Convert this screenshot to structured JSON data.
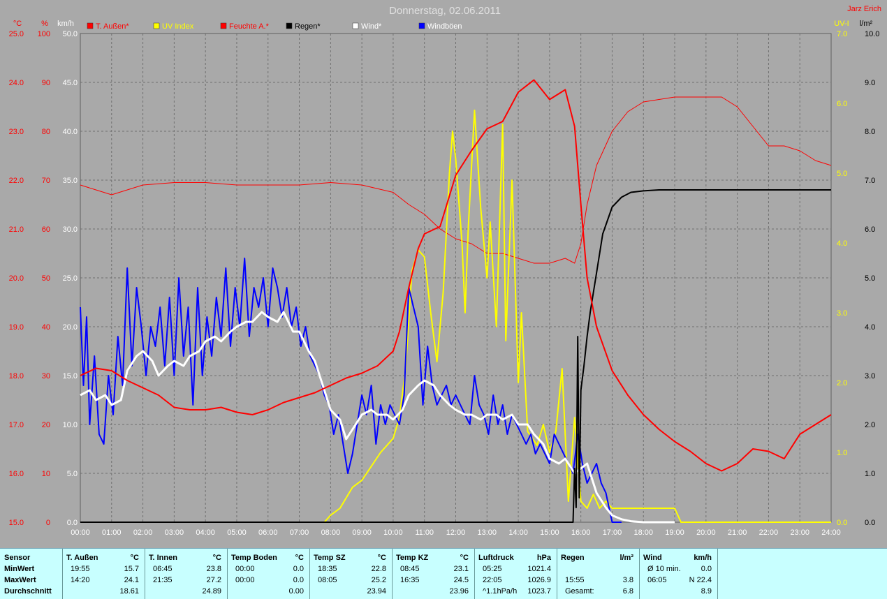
{
  "title": "Donnerstag, 02.06.2011",
  "author": "Jarz Erich",
  "colors": {
    "temp": "#ff0000",
    "uv": "#ffff00",
    "hum": "#ff0000",
    "rain": "#000000",
    "wind": "#ffffff",
    "gust": "#0000ff",
    "grid": "#707070",
    "plot_bg": "#a9a9a9"
  },
  "chart_data": {
    "type": "line",
    "title": "Donnerstag, 02.06.2011",
    "x_ticks": [
      "00:00",
      "01:00",
      "02:00",
      "03:00",
      "04:00",
      "05:00",
      "06:00",
      "07:00",
      "08:00",
      "09:00",
      "10:00",
      "11:00",
      "12:00",
      "13:00",
      "14:00",
      "15:00",
      "16:00",
      "17:00",
      "18:00",
      "19:00",
      "20:00",
      "21:00",
      "22:00",
      "23:00",
      "24:00"
    ],
    "axes": {
      "temp": {
        "unit": "°C",
        "range": [
          15,
          25
        ],
        "ticks": [
          "15.0",
          "16.0",
          "17.0",
          "18.0",
          "19.0",
          "20.0",
          "21.0",
          "22.0",
          "23.0",
          "24.0",
          "25.0"
        ]
      },
      "hum": {
        "unit": "%",
        "range": [
          0,
          100
        ],
        "ticks": [
          "0",
          "10",
          "20",
          "30",
          "40",
          "50",
          "60",
          "70",
          "80",
          "90",
          "100"
        ]
      },
      "wind": {
        "unit": "km/h",
        "range": [
          0,
          50
        ],
        "ticks": [
          "0.0",
          "5.0",
          "10.0",
          "15.0",
          "20.0",
          "25.0",
          "30.0",
          "35.0",
          "40.0",
          "45.0",
          "50.0"
        ]
      },
      "uv": {
        "unit": "UV-I",
        "range": [
          0,
          7
        ],
        "ticks": [
          "0.0",
          "1.0",
          "2.0",
          "3.0",
          "4.0",
          "5.0",
          "6.0",
          "7.0"
        ]
      },
      "rain": {
        "unit": "l/m²",
        "range": [
          0,
          10
        ],
        "ticks": [
          "0.0",
          "1.0",
          "2.0",
          "3.0",
          "4.0",
          "5.0",
          "6.0",
          "7.0",
          "8.0",
          "9.0",
          "10.0"
        ]
      }
    },
    "legend": [
      "T. Außen*",
      "UV Index",
      "Feuchte A.*",
      "Regen*",
      "Wind*",
      "Windböen"
    ],
    "grid": true,
    "series": [
      {
        "name": "T. Außen*",
        "axis": "temp",
        "x": [
          0,
          0.5,
          1,
          1.5,
          2,
          2.5,
          3,
          3.5,
          4,
          4.5,
          5,
          5.5,
          6,
          6.5,
          7,
          7.5,
          8,
          8.5,
          9,
          9.5,
          10,
          10.2,
          10.5,
          10.8,
          11,
          11.5,
          12,
          12.5,
          13,
          13.5,
          14,
          14.5,
          15,
          15.5,
          15.8,
          16,
          16.2,
          16.5,
          17,
          17.5,
          18,
          18.5,
          19,
          19.5,
          20,
          20.5,
          21,
          21.5,
          22,
          22.5,
          23,
          23.5,
          24
        ],
        "y": [
          18.0,
          18.15,
          18.1,
          17.9,
          17.75,
          17.6,
          17.35,
          17.3,
          17.3,
          17.35,
          17.25,
          17.2,
          17.3,
          17.45,
          17.55,
          17.65,
          17.8,
          17.95,
          18.05,
          18.2,
          18.5,
          18.9,
          19.8,
          20.6,
          20.9,
          21.05,
          22.1,
          22.6,
          23.05,
          23.2,
          23.8,
          24.05,
          23.65,
          23.85,
          23.1,
          21.5,
          20.0,
          19.0,
          18.1,
          17.6,
          17.2,
          16.9,
          16.65,
          16.45,
          16.2,
          16.05,
          16.2,
          16.5,
          16.45,
          16.3,
          16.8,
          17.0,
          17.2
        ]
      },
      {
        "name": "Feuchte A.*",
        "axis": "hum",
        "x": [
          0,
          0.5,
          1,
          1.5,
          2,
          3,
          4,
          5,
          6,
          7,
          8,
          9,
          10,
          10.5,
          11,
          11.5,
          12,
          12.5,
          13,
          13.5,
          14,
          14.5,
          15,
          15.5,
          15.8,
          16,
          16.2,
          16.5,
          17,
          17.5,
          18,
          19,
          20,
          20.5,
          21,
          21.5,
          22,
          22.5,
          23,
          23.5,
          24
        ],
        "y": [
          69,
          68,
          67,
          68,
          69,
          69.5,
          69.5,
          69,
          69,
          69,
          69.5,
          69,
          67.5,
          65,
          63,
          60,
          58,
          57,
          55,
          55,
          54,
          53,
          53,
          54,
          53,
          57,
          65,
          73,
          80,
          84,
          86,
          87,
          87,
          87,
          85,
          81,
          77,
          77,
          76,
          74,
          73
        ]
      },
      {
        "name": "Regen*",
        "axis": "rain",
        "x": [
          0,
          15.7,
          15.75,
          15.8,
          15.85,
          15.9,
          15.95,
          16,
          16.1,
          16.2,
          16.3,
          16.5,
          16.7,
          17,
          17.3,
          17.6,
          18,
          18.5,
          24
        ],
        "y": [
          0,
          0,
          0,
          1.1,
          0.3,
          3.8,
          0.5,
          2.7,
          3.2,
          3.8,
          4.3,
          5.1,
          5.9,
          6.45,
          6.65,
          6.75,
          6.78,
          6.8,
          6.8
        ]
      },
      {
        "name": "UV Index",
        "axis": "uv",
        "x": [
          0,
          7.8,
          8,
          8.3,
          8.7,
          9,
          9.3,
          9.6,
          10,
          10.2,
          10.4,
          10.6,
          10.8,
          11,
          11.2,
          11.4,
          11.6,
          11.8,
          11.9,
          12,
          12.2,
          12.3,
          12.4,
          12.6,
          12.8,
          13,
          13.1,
          13.3,
          13.5,
          13.6,
          13.8,
          14,
          14.1,
          14.3,
          14.6,
          14.8,
          15,
          15.2,
          15.4,
          15.6,
          15.8,
          16,
          16.2,
          16.4,
          16.6,
          16.8,
          17,
          17.5,
          18,
          18.5,
          19,
          19.2,
          24
        ],
        "y": [
          0,
          0,
          0.1,
          0.2,
          0.5,
          0.6,
          0.8,
          1.0,
          1.2,
          1.5,
          2.2,
          3.6,
          3.9,
          3.8,
          3.0,
          2.3,
          3.3,
          5.0,
          5.6,
          5.2,
          4.0,
          3.0,
          4.2,
          5.9,
          4.5,
          3.5,
          4.3,
          2.8,
          5.7,
          2.6,
          4.9,
          2.0,
          3.0,
          1.3,
          1.1,
          1.4,
          1.0,
          1.3,
          2.2,
          0.3,
          1.5,
          0.3,
          0.2,
          0.4,
          0.2,
          0.3,
          0.2,
          0.2,
          0.2,
          0.2,
          0.2,
          0,
          0
        ]
      },
      {
        "name": "Wind*",
        "axis": "wind",
        "x": [
          0,
          0.3,
          0.5,
          0.8,
          1,
          1.3,
          1.5,
          1.8,
          2,
          2.3,
          2.5,
          2.8,
          3,
          3.3,
          3.5,
          3.8,
          4,
          4.3,
          4.5,
          4.8,
          5,
          5.3,
          5.5,
          5.8,
          6,
          6.3,
          6.5,
          6.8,
          7,
          7.3,
          7.5,
          7.8,
          8,
          8.3,
          8.5,
          8.8,
          9,
          9.3,
          9.5,
          9.8,
          10,
          10.3,
          10.5,
          10.8,
          11,
          11.3,
          11.5,
          11.8,
          12,
          12.3,
          12.5,
          12.8,
          13,
          13.3,
          13.5,
          13.8,
          14,
          14.3,
          14.5,
          14.8,
          15,
          15.3,
          15.5,
          15.8,
          16,
          16.2,
          16.5,
          16.8,
          17,
          17.3,
          17.6,
          18,
          19
        ],
        "y": [
          13,
          13.5,
          12.5,
          13,
          12,
          12.5,
          15.5,
          17,
          17.5,
          16.5,
          15,
          16,
          16.5,
          16,
          17,
          17.5,
          18.5,
          19,
          18.5,
          19.5,
          20,
          20.5,
          20.5,
          21.5,
          21,
          20.5,
          21.5,
          19.5,
          19.5,
          17.5,
          16.5,
          13.5,
          11.5,
          10.5,
          8.5,
          10,
          11,
          11.5,
          11,
          11,
          10.5,
          11.5,
          13,
          14,
          14.5,
          14,
          13,
          12,
          11.5,
          11,
          11,
          10.5,
          11,
          11,
          10.5,
          11,
          10,
          10,
          9,
          8,
          6.5,
          6,
          6.5,
          5,
          5.5,
          6,
          3,
          1.5,
          0.7,
          0.3,
          0.1,
          0,
          0
        ]
      },
      {
        "name": "Windböen",
        "axis": "wind",
        "x": [
          0,
          0.1,
          0.2,
          0.3,
          0.45,
          0.6,
          0.75,
          0.9,
          1.05,
          1.2,
          1.35,
          1.5,
          1.65,
          1.8,
          1.95,
          2.1,
          2.25,
          2.4,
          2.55,
          2.7,
          2.85,
          3,
          3.15,
          3.3,
          3.45,
          3.6,
          3.75,
          3.9,
          4.05,
          4.2,
          4.35,
          4.5,
          4.65,
          4.8,
          4.95,
          5.1,
          5.25,
          5.4,
          5.55,
          5.7,
          5.85,
          6,
          6.15,
          6.3,
          6.45,
          6.6,
          6.75,
          6.9,
          7.05,
          7.2,
          7.35,
          7.5,
          7.65,
          7.8,
          7.95,
          8.1,
          8.25,
          8.4,
          8.55,
          8.7,
          8.85,
          9,
          9.15,
          9.3,
          9.45,
          9.6,
          9.75,
          9.9,
          10.05,
          10.2,
          10.35,
          10.5,
          10.65,
          10.8,
          10.95,
          11.1,
          11.25,
          11.4,
          11.55,
          11.7,
          11.85,
          12,
          12.15,
          12.3,
          12.45,
          12.6,
          12.75,
          12.9,
          13.05,
          13.2,
          13.35,
          13.5,
          13.65,
          13.8,
          13.95,
          14.1,
          14.25,
          14.4,
          14.55,
          14.7,
          14.85,
          15,
          15.15,
          15.3,
          15.45,
          15.6,
          15.75,
          15.9,
          16.05,
          16.2,
          16.35,
          16.5,
          16.65,
          16.8,
          17,
          17.3
        ],
        "y": [
          22,
          14,
          21,
          10,
          17,
          9,
          8,
          15,
          11,
          19,
          14,
          26,
          16,
          24,
          20,
          15,
          20,
          18,
          22,
          16,
          23,
          15,
          25,
          17,
          22,
          12,
          24,
          15,
          21,
          17,
          23,
          19,
          26,
          18,
          24,
          20,
          27,
          19,
          24,
          22,
          25,
          20,
          26,
          24,
          21,
          24,
          20,
          22,
          18,
          20,
          17,
          16,
          15,
          13,
          12,
          9,
          11,
          8,
          5,
          7,
          10,
          13,
          11,
          14,
          8,
          12,
          10,
          12,
          11,
          10,
          13,
          24,
          22,
          20,
          12,
          18,
          14,
          12,
          13,
          14,
          12,
          13,
          12,
          11,
          10,
          15,
          12,
          11,
          9,
          13,
          10,
          12,
          9,
          11,
          10,
          9,
          8,
          9,
          7,
          8,
          7,
          6,
          9,
          8,
          7,
          6,
          5,
          9,
          6,
          4,
          5,
          6,
          4,
          3,
          0,
          0
        ]
      }
    ]
  },
  "stats": {
    "columns": [
      {
        "header": "Sensor",
        "rows": [
          [
            "MinWert",
            "",
            ""
          ],
          [
            "MaxWert",
            "",
            ""
          ],
          [
            "Durchschnitt",
            "",
            ""
          ]
        ]
      },
      {
        "header": "T. Außen",
        "unit": "°C",
        "rows": [
          [
            "19:55",
            "15.7"
          ],
          [
            "14:20",
            "24.1"
          ],
          [
            "",
            "18.61"
          ]
        ]
      },
      {
        "header": "T. Innen",
        "unit": "°C",
        "rows": [
          [
            "06:45",
            "23.8"
          ],
          [
            "21:35",
            "27.2"
          ],
          [
            "",
            "24.89"
          ]
        ]
      },
      {
        "header": "Temp Boden",
        "unit": "°C",
        "rows": [
          [
            "00:00",
            "0.0"
          ],
          [
            "00:00",
            "0.0"
          ],
          [
            "",
            "0.00"
          ]
        ]
      },
      {
        "header": "Temp SZ",
        "unit": "°C",
        "rows": [
          [
            "18:35",
            "22.8"
          ],
          [
            "08:05",
            "25.2"
          ],
          [
            "",
            "23.94"
          ]
        ]
      },
      {
        "header": "Temp KZ",
        "unit": "°C",
        "rows": [
          [
            "08:45",
            "23.1"
          ],
          [
            "16:35",
            "24.5"
          ],
          [
            "",
            "23.96"
          ]
        ]
      },
      {
        "header": "Luftdruck",
        "unit": "hPa",
        "rows": [
          [
            "05:25",
            "1021.4"
          ],
          [
            "22:05",
            "1026.9"
          ],
          [
            "^1.1hPa/h",
            "1023.7"
          ]
        ]
      },
      {
        "header": "Regen",
        "unit": "l/m²",
        "rows": [
          [
            "",
            ""
          ],
          [
            "15:55",
            "3.8"
          ],
          [
            "Gesamt:",
            "6.8"
          ]
        ]
      },
      {
        "header": "Wind",
        "unit": "km/h",
        "rows": [
          [
            "Ø 10 min.",
            "0.0"
          ],
          [
            "06:05",
            "N 22.4"
          ],
          [
            "",
            "8.9"
          ]
        ]
      }
    ]
  }
}
